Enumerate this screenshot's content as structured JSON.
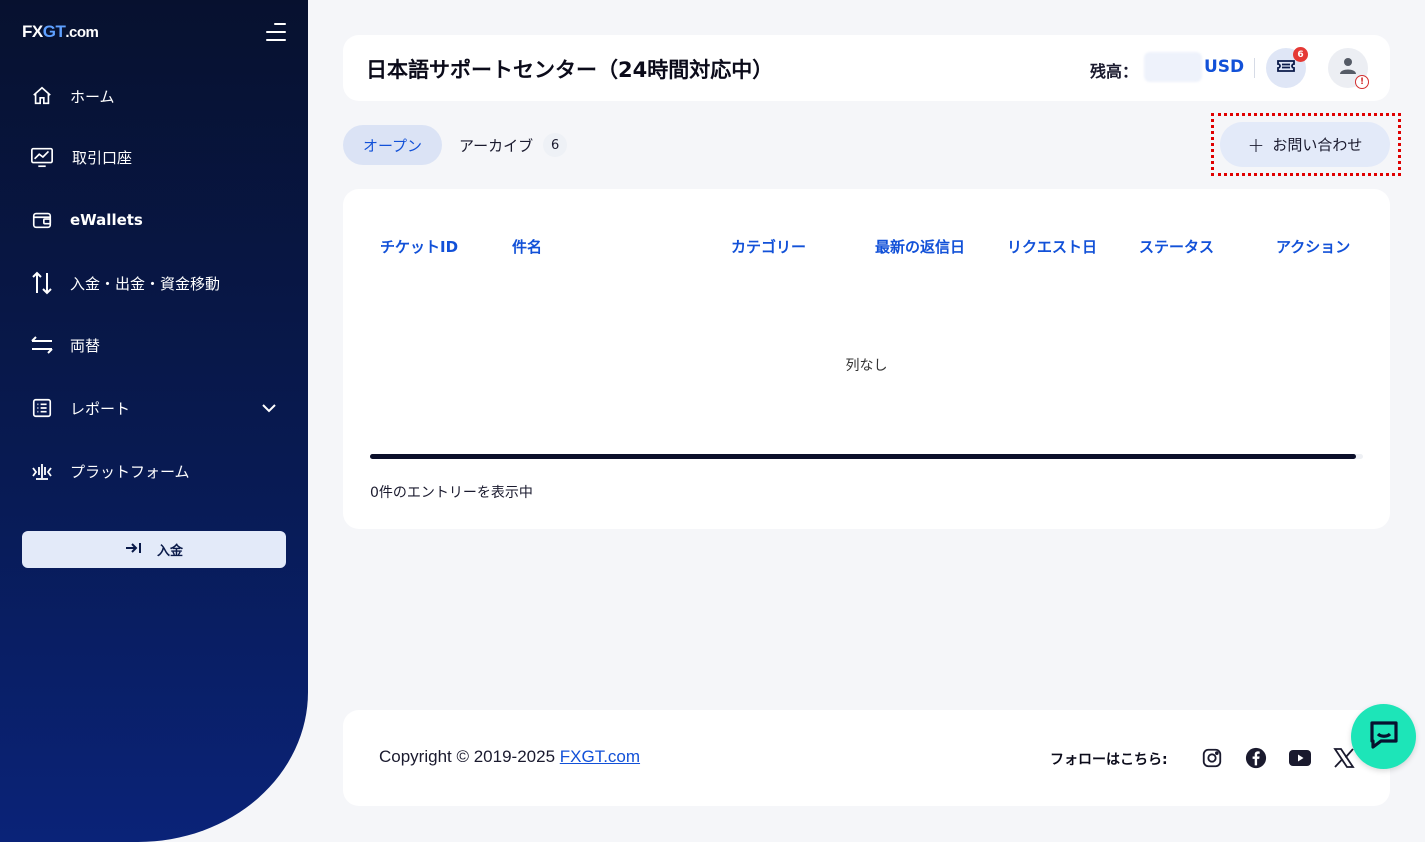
{
  "app": {
    "logo": {
      "part1": "FX",
      "part2": "GT",
      "part3": ".com"
    }
  },
  "sidebar": {
    "items": [
      {
        "label": "ホーム",
        "icon": "home-icon"
      },
      {
        "label": "取引口座",
        "icon": "chart-monitor-icon"
      },
      {
        "label": "eWallets",
        "icon": "wallet-icon"
      },
      {
        "label": "入金・出金・資金移動",
        "icon": "transfer-arrows-icon"
      },
      {
        "label": "両替",
        "icon": "exchange-icon"
      },
      {
        "label": "レポート",
        "icon": "report-list-icon"
      },
      {
        "label": "プラットフォーム",
        "icon": "platform-icon"
      }
    ],
    "deposit_button": "入金"
  },
  "header": {
    "title": "日本語サポートセンター（24時間対応中）",
    "balance_label": "残高：",
    "currency": "USD",
    "ticket_badge": "6",
    "user_alert": "!"
  },
  "tabs": {
    "open": "オープン",
    "archive": "アーカイブ",
    "archive_count": "6"
  },
  "contact_button": {
    "plus": "+",
    "label": "お問い合わせ"
  },
  "table": {
    "columns": [
      "チケットID",
      "件名",
      "カテゴリー",
      "最新の返信日",
      "リクエスト日",
      "ステータス",
      "アクション"
    ],
    "rows": [],
    "empty_message": "列なし",
    "entries_text": "0件のエントリーを表示中"
  },
  "footer": {
    "copyright_prefix": "Copyright © 2019-2025 ",
    "copyright_link": "FXGT.com",
    "follow_label": "フォローはこちら:"
  },
  "colors": {
    "accent": "#1251d8",
    "sidebar_top": "#07112f",
    "sidebar_bottom": "#0a2378",
    "chat": "#1de5b8",
    "badge": "#e53935",
    "highlight_outline": "#e00000"
  }
}
